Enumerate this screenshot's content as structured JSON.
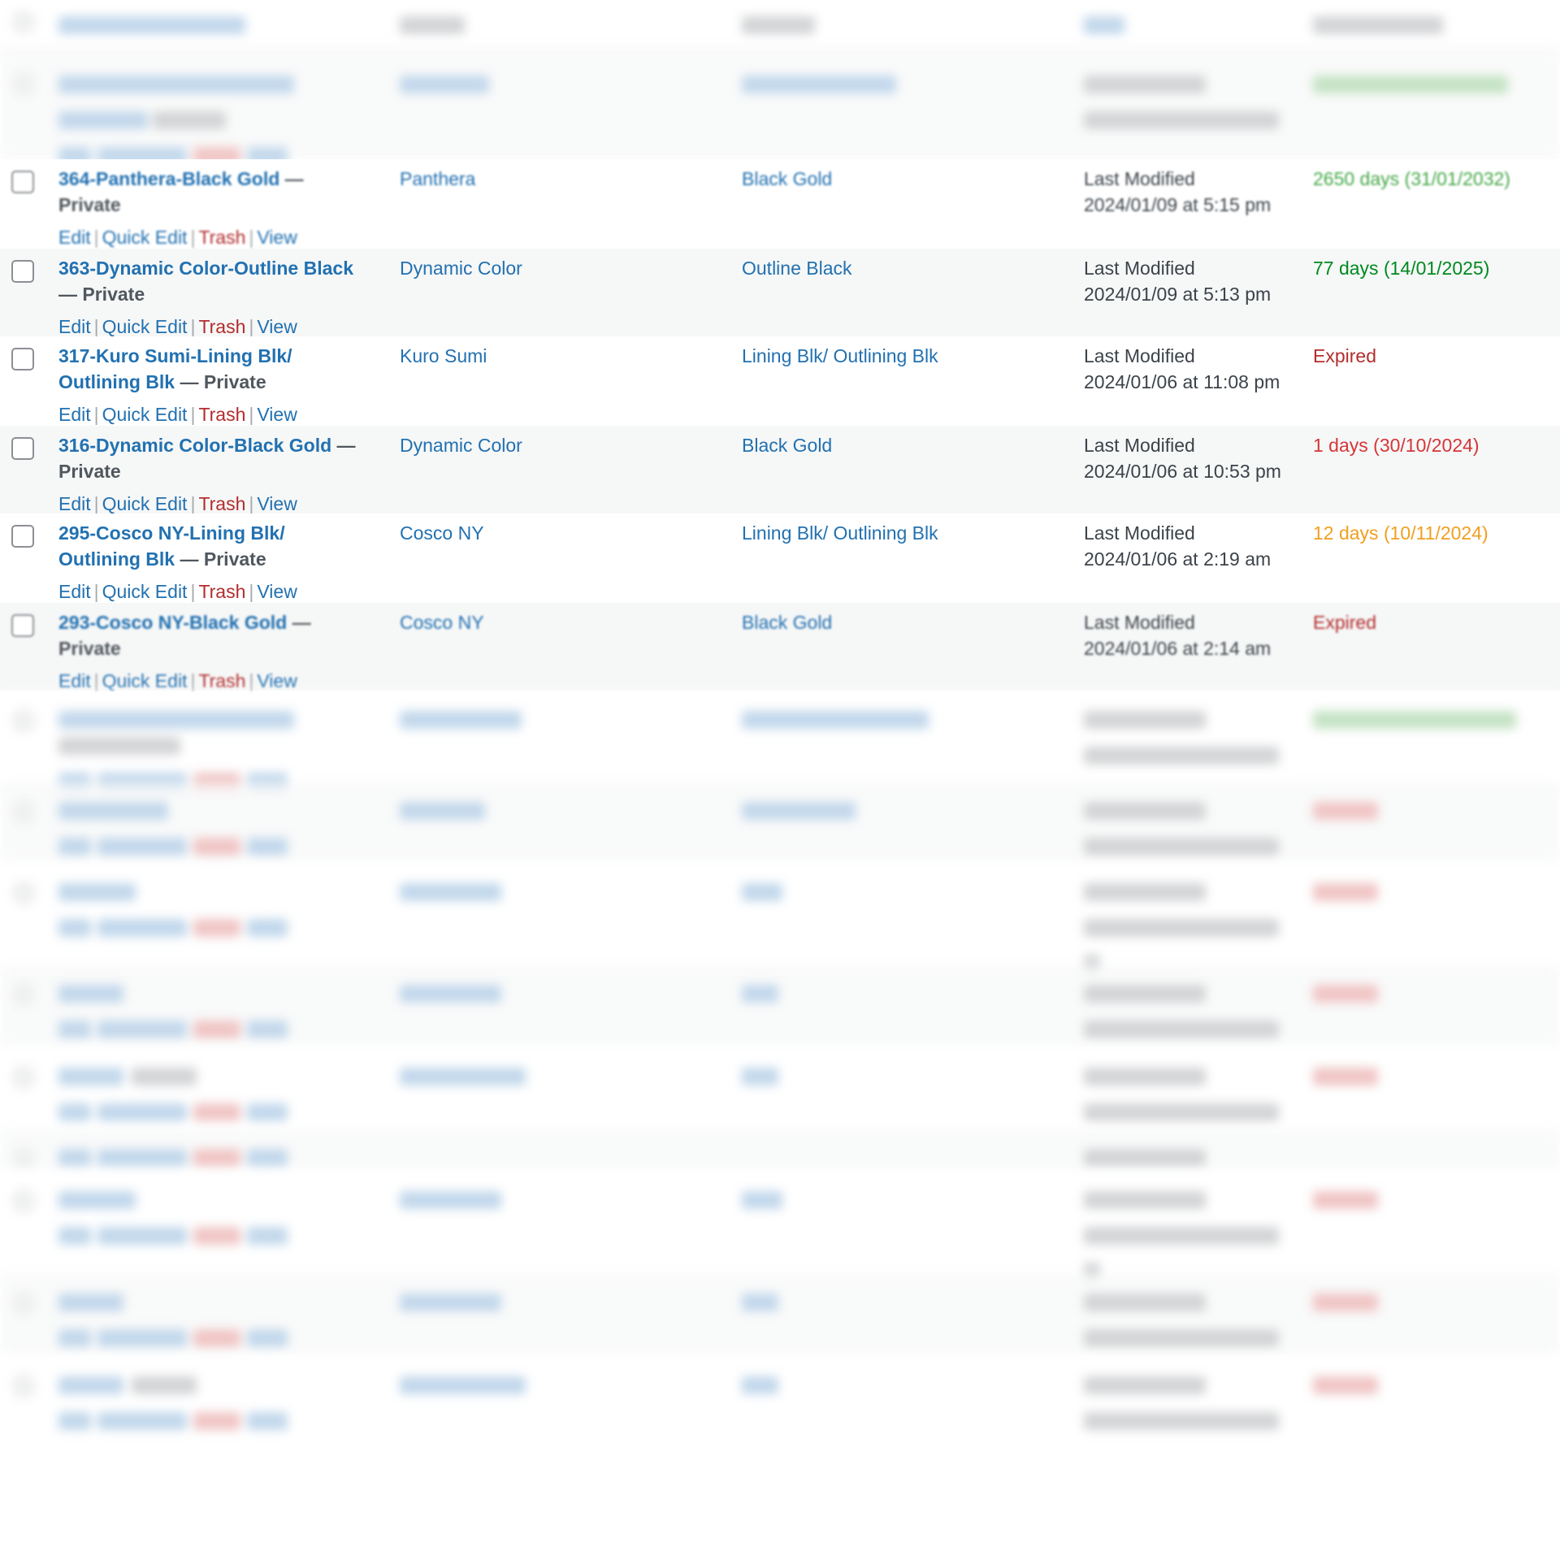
{
  "table": {
    "columns": [
      "",
      "Title",
      "Brand",
      "Colour",
      "Date",
      "Expiration"
    ],
    "header_legible": false,
    "row_actions": {
      "edit": "Edit",
      "quick_edit": "Quick Edit",
      "trash": "Trash",
      "view": "View",
      "separator": "|"
    },
    "rows": [
      {
        "title": "364-Panthera-Black Gold",
        "state": "— Private",
        "brand": "Panthera",
        "colour": "Black Gold",
        "date_label": "Last Modified",
        "date_value": "2024/01/09 at 5:15 pm",
        "expiration": "2650 days (31/01/2032)",
        "expiration_status": "long"
      },
      {
        "title": "363-Dynamic Color-Outline Black",
        "state": "— Private",
        "brand": "Dynamic Color",
        "colour": "Outline Black",
        "date_label": "Last Modified",
        "date_value": "2024/01/09 at 5:13 pm",
        "expiration": "77 days (14/01/2025)",
        "expiration_status": "ok"
      },
      {
        "title": "317-Kuro Sumi-Lining Blk/ Outlining Blk",
        "state": "— Private",
        "brand": "Kuro Sumi",
        "colour": "Lining Blk/ Outlining Blk",
        "date_label": "Last Modified",
        "date_value": "2024/01/06 at 11:08 pm",
        "expiration": "Expired",
        "expiration_status": "expired"
      },
      {
        "title": "316-Dynamic Color-Black Gold",
        "state": "— Private",
        "brand": "Dynamic Color",
        "colour": "Black Gold",
        "date_label": "Last Modified",
        "date_value": "2024/01/06 at 10:53 pm",
        "expiration": "1 days (30/10/2024)",
        "expiration_status": "critical"
      },
      {
        "title": "295-Cosco NY-Lining Blk/ Outlining Blk",
        "state": "— Private",
        "brand": "Cosco NY",
        "colour": "Lining Blk/ Outlining Blk",
        "date_label": "Last Modified",
        "date_value": "2024/01/06 at 2:19 am",
        "expiration": "12 days (10/11/2024)",
        "expiration_status": "warning"
      },
      {
        "title": "293-Cosco NY-Black Gold",
        "state": "— Private",
        "brand": "Cosco NY",
        "colour": "Black Gold",
        "date_label": "Last Modified",
        "date_value": "2024/01/06 at 2:14 am",
        "expiration": "Expired",
        "expiration_status": "expired"
      }
    ]
  },
  "colors": {
    "link": "#2271b1",
    "trash": "#b32d2e",
    "expired": "#b32d2e",
    "critical": "#d63638",
    "warning": "#f0a020",
    "ok": "#008a20",
    "long": "#46a848",
    "row_alt_bg": "#f6f7f7"
  }
}
